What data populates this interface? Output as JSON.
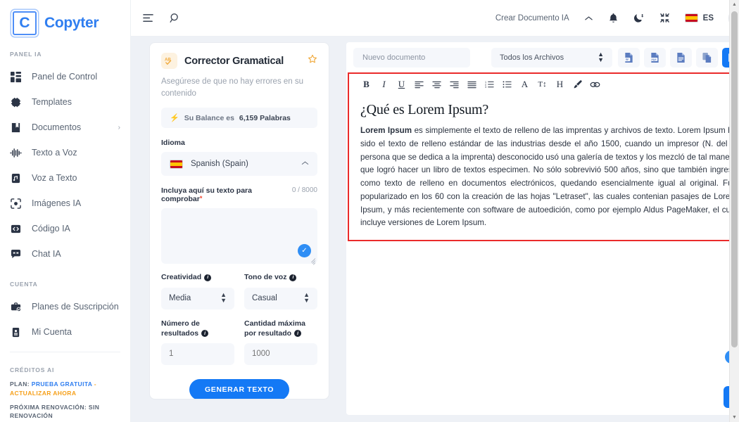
{
  "brand": {
    "logo_letter": "C",
    "name": "Copyter"
  },
  "sidebar": {
    "section_panel": "PANEL IA",
    "items": [
      {
        "label": "Panel de Control",
        "icon": "dashboard-icon"
      },
      {
        "label": "Templates",
        "icon": "chip-icon"
      },
      {
        "label": "Documentos",
        "icon": "book-icon",
        "chevron": "›"
      },
      {
        "label": "Texto a Voz",
        "icon": "waveform-icon"
      },
      {
        "label": "Voz a Texto",
        "icon": "audio-file-icon"
      },
      {
        "label": "Imágenes IA",
        "icon": "camera-frame-icon"
      },
      {
        "label": "Código IA",
        "icon": "code-icon"
      },
      {
        "label": "Chat IA",
        "icon": "chat-icon"
      }
    ],
    "section_account": "CUENTA",
    "account_items": [
      {
        "label": "Planes de Suscripción",
        "icon": "briefcase-check-icon"
      },
      {
        "label": "Mi Cuenta",
        "icon": "id-card-icon"
      }
    ],
    "section_credits": "CRÉDITOS AI",
    "plan_prefix": "PLAN:",
    "plan_value": "PRUEBA GRATUITA",
    "plan_dash": "-",
    "plan_action": "ACTUALIZAR AHORA",
    "renewal": "PRÓXIMA RENOVACIÓN: SIN RENOVACIÓN"
  },
  "topbar": {
    "menu_icon": "menu-collapse-icon",
    "search_icon": "search-icon",
    "create_doc": "Crear Documento IA",
    "chevron": "⌃",
    "bell_icon": "bell-icon",
    "moon_icon": "moon-icon",
    "fullscreen_icon": "collapse-screen-icon",
    "language": "ES",
    "flag": "spain-flag"
  },
  "tool": {
    "badge": "spellcheck-icon",
    "title": "Corrector Gramatical",
    "star": "star-icon",
    "subtitle": "Asegúrese de que no hay errores en su contenido",
    "balance_text": "Su Balance es",
    "balance_value": "6,159 Palabras",
    "language_label": "Idioma",
    "language_value": "Spanish (Spain)",
    "text_label": "Incluya aquí su texto para comprobar",
    "text_required": "*",
    "text_counter": "0 / 8000",
    "textarea_value": "",
    "creativity_label": "Creatividad",
    "creativity_value": "Media",
    "tone_label": "Tono de voz",
    "tone_value": "Casual",
    "results_label": "Número de resultados",
    "results_value": "1",
    "maxamount_label": "Cantidad máxima por resultado",
    "maxamount_value": "1000",
    "generate_button": "GENERAR TEXTO"
  },
  "editor": {
    "doc_name_placeholder": "Nuevo documento",
    "doc_name_value": "",
    "file_filter": "Todos los Archivos",
    "export_buttons": [
      {
        "name": "export-word-button",
        "label": "W"
      },
      {
        "name": "export-pdf-button",
        "label": "PDF"
      },
      {
        "name": "export-txt-button",
        "label": ""
      },
      {
        "name": "copy-document-button",
        "label": ""
      },
      {
        "name": "save-document-button",
        "label": ""
      }
    ],
    "format_buttons": [
      {
        "name": "bold-button",
        "glyph": "B"
      },
      {
        "name": "italic-button",
        "glyph": "I"
      },
      {
        "name": "underline-button",
        "glyph": "U"
      },
      {
        "name": "align-left-button",
        "glyph": "align-left-icon"
      },
      {
        "name": "align-center-button",
        "glyph": "align-center-icon"
      },
      {
        "name": "align-right-button",
        "glyph": "align-right-icon"
      },
      {
        "name": "align-justify-button",
        "glyph": "align-justify-icon"
      },
      {
        "name": "ordered-list-button",
        "glyph": "ordered-list-icon"
      },
      {
        "name": "bullet-list-button",
        "glyph": "bullet-list-icon"
      },
      {
        "name": "font-color-button",
        "glyph": "A"
      },
      {
        "name": "font-size-button",
        "glyph": "T↕"
      },
      {
        "name": "heading-button",
        "glyph": "H"
      },
      {
        "name": "brush-button",
        "glyph": "brush-icon"
      },
      {
        "name": "link-button",
        "glyph": "link-icon"
      }
    ],
    "doc_heading": "¿Qué es Lorem Ipsum?",
    "doc_bold_lead": "Lorem Ipsum",
    "doc_paragraph": " es simplemente el texto de relleno de las imprentas y archivos de texto. Lorem Ipsum ha sido el texto de relleno estándar de las industrias desde el año 1500, cuando un impresor (N. del T. persona que se dedica a la imprenta) desconocido usó una galería de textos y los mezcló de tal manera que logró hacer un libro de textos especimen. No sólo sobrevivió 500 años, sino que también ingresó como texto de relleno en documentos electrónicos, quedando esencialmente igual al original. Fue popularizado en los 60 con la creación de las hojas \"Letraset\", las cuales contenian pasajes de Lorem Ipsum, y más recientemente con software de autoedición, como por ejemplo Aldus PageMaker, el cual incluye versiones de Lorem Ipsum.",
    "scroll_top_icon": "double-chevron-up-icon",
    "check_icon": "check-circle-icon"
  },
  "colors": {
    "brand_blue": "#2f7ef0",
    "accent_blue": "#1479f5",
    "highlight_red": "#ea2b2b",
    "orange": "#f6a01a",
    "panel_bg": "#eef1f6",
    "field_bg": "#f5f7fb"
  }
}
